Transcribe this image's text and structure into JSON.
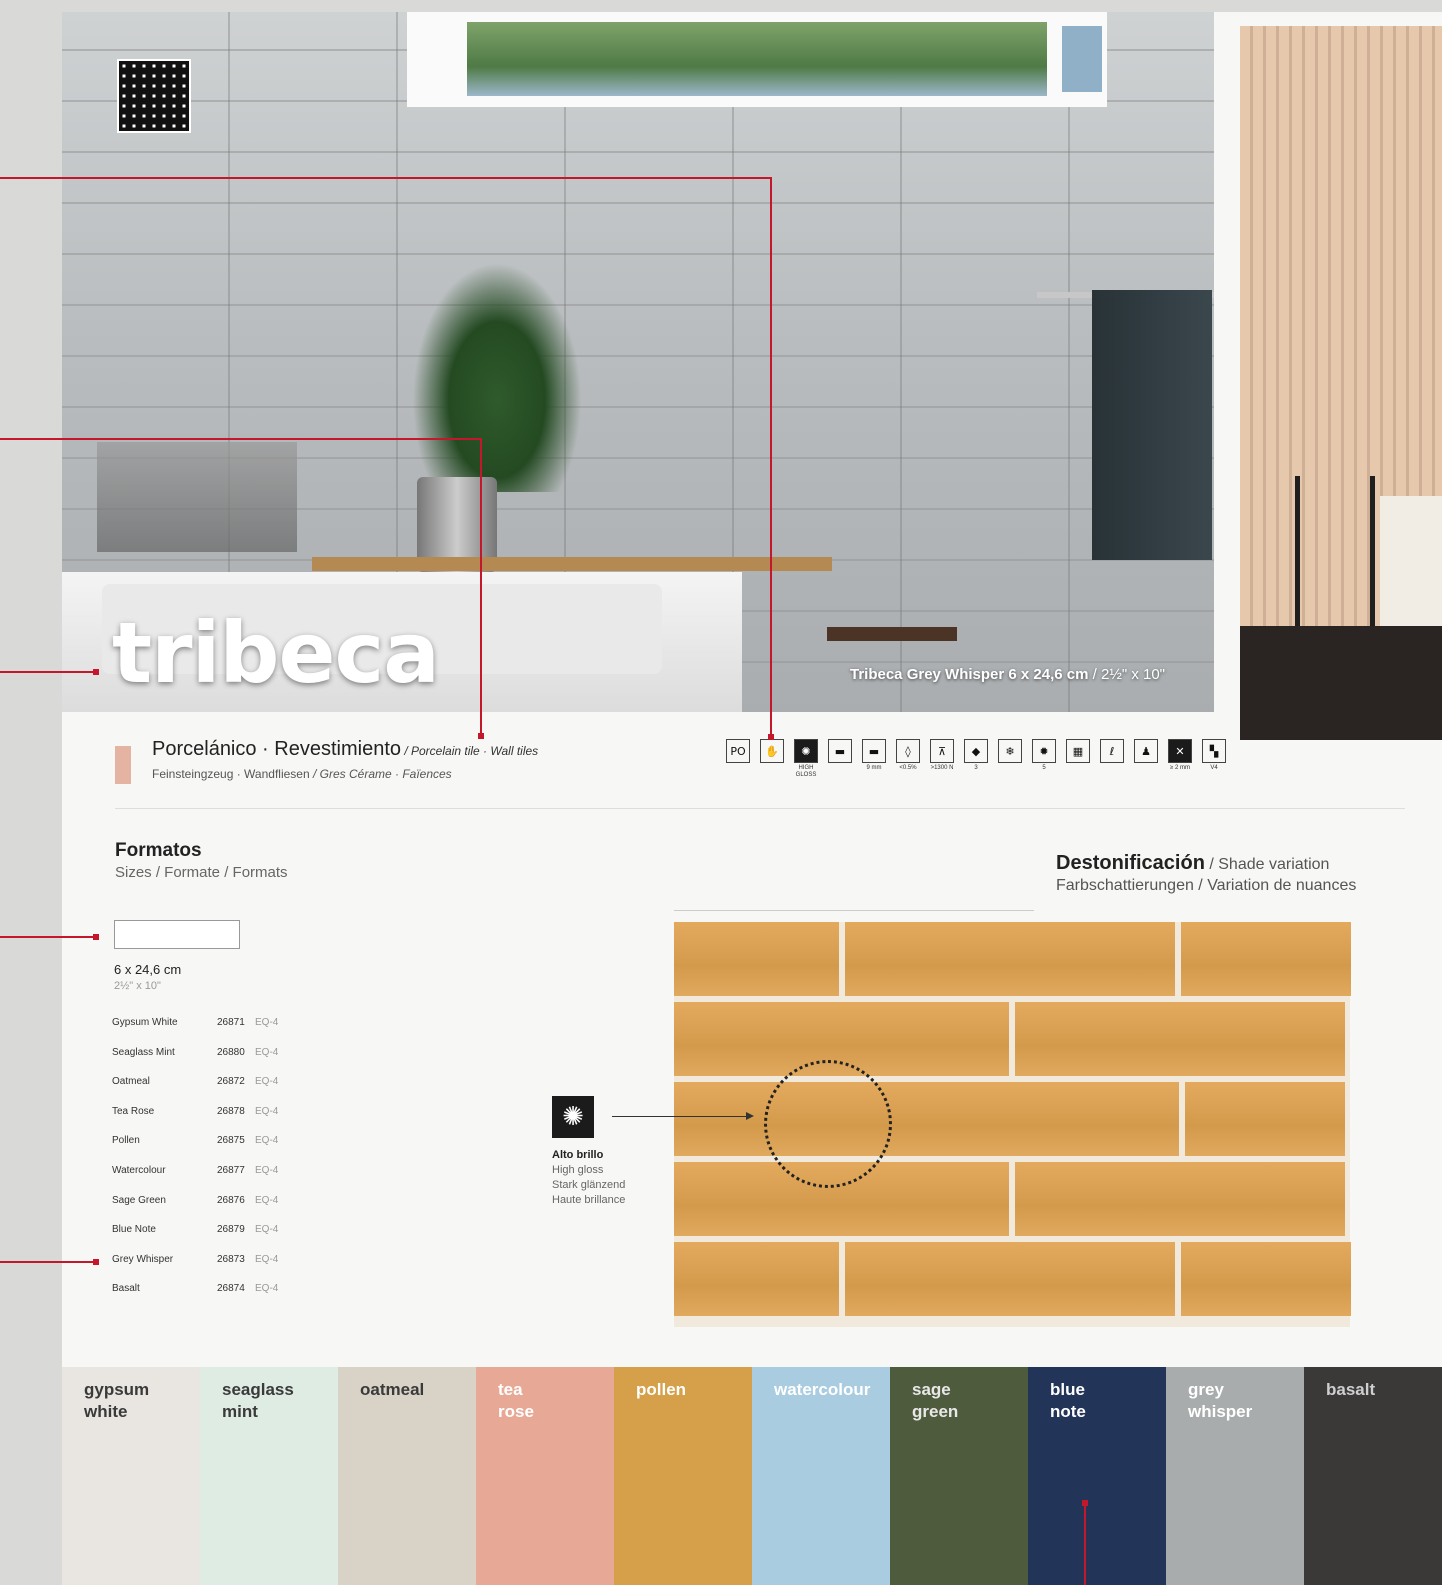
{
  "hero": {
    "title": "tribeca",
    "caption_main": "Tribeca Grey Whisper 6 x 24,6 cm",
    "caption_alt": " / 2½\" x 10\""
  },
  "header": {
    "main": "Porcelánico · Revestimiento",
    "main_alt": " / Porcelain tile · Wall tiles",
    "sub": "Feinsteingzeug · Wandfliesen",
    "sub_alt": " / Gres Cérame · Faïences"
  },
  "icons": [
    {
      "name": "po-icon",
      "glyph": "PO",
      "label": "",
      "solid": false
    },
    {
      "name": "hand-icon",
      "glyph": "✋",
      "label": "",
      "solid": false
    },
    {
      "name": "high-gloss-icon",
      "glyph": "✺",
      "label": "HIGH GLOSS",
      "solid": true
    },
    {
      "name": "tile-shape-icon",
      "glyph": "▬",
      "label": "",
      "solid": false
    },
    {
      "name": "thickness-icon",
      "glyph": "▬",
      "label": "9 mm",
      "solid": false
    },
    {
      "name": "water-drop-icon",
      "glyph": "◊",
      "label": "<0.5%",
      "solid": false
    },
    {
      "name": "breaking-strength-icon",
      "glyph": "⊼",
      "label": ">1300 N",
      "solid": false
    },
    {
      "name": "abrasion-icon",
      "glyph": "◆",
      "label": "3",
      "solid": false
    },
    {
      "name": "frost-icon",
      "glyph": "❄",
      "label": "",
      "solid": false
    },
    {
      "name": "light-icon",
      "glyph": "✹",
      "label": "5",
      "solid": false
    },
    {
      "name": "pattern-icon",
      "glyph": "▦",
      "label": "",
      "solid": false
    },
    {
      "name": "thermal-icon",
      "glyph": "ℓ",
      "label": "",
      "solid": false
    },
    {
      "name": "chemical-icon",
      "glyph": "♟",
      "label": "",
      "solid": false
    },
    {
      "name": "joint-icon",
      "glyph": "✕",
      "label": "≥ 2 mm",
      "solid": true
    },
    {
      "name": "variation-icon",
      "glyph": "▚",
      "label": "V4",
      "solid": false
    }
  ],
  "formats": {
    "title": "Formatos",
    "subtitle": "Sizes / Formate / Formats",
    "size_cm": "6 x 24,6 cm",
    "size_in": "2½\" x 10\"",
    "refs": [
      {
        "name": "Gypsum White",
        "code": "26871",
        "eq": "EQ-4"
      },
      {
        "name": "Seaglass Mint",
        "code": "26880",
        "eq": "EQ-4"
      },
      {
        "name": "Oatmeal",
        "code": "26872",
        "eq": "EQ-4"
      },
      {
        "name": "Tea Rose",
        "code": "26878",
        "eq": "EQ-4"
      },
      {
        "name": "Pollen",
        "code": "26875",
        "eq": "EQ-4"
      },
      {
        "name": "Watercolour",
        "code": "26877",
        "eq": "EQ-4"
      },
      {
        "name": "Sage Green",
        "code": "26876",
        "eq": "EQ-4"
      },
      {
        "name": "Blue Note",
        "code": "26879",
        "eq": "EQ-4"
      },
      {
        "name": "Grey Whisper",
        "code": "26873",
        "eq": "EQ-4"
      },
      {
        "name": "Basalt",
        "code": "26874",
        "eq": "EQ-4"
      }
    ]
  },
  "shade": {
    "title": "Destonificación",
    "title_alt": " / Shade variation",
    "subtitle": "Farbschattierungen / Variation de nuances"
  },
  "gloss": {
    "title": "Alto brillo",
    "en": "High gloss",
    "de": "Stark glänzend",
    "fr": "Haute brillance"
  },
  "colors": [
    {
      "label": "gypsum\nwhite",
      "bg": "#e9e6e1",
      "fg": "#3a3a3a"
    },
    {
      "label": "seaglass\nmint",
      "bg": "#dfece4",
      "fg": "#3a3a3a"
    },
    {
      "label": "oatmeal",
      "bg": "#d9d2c7",
      "fg": "#3a3a3a"
    },
    {
      "label": "tea\nrose",
      "bg": "#e7a895",
      "fg": "#ffffff"
    },
    {
      "label": "pollen",
      "bg": "#d5a049",
      "fg": "#ffffff"
    },
    {
      "label": "watercolour",
      "bg": "#a9cce0",
      "fg": "#ffffff"
    },
    {
      "label": "sage\ngreen",
      "bg": "#4f5b3d",
      "fg": "#e8e8e8"
    },
    {
      "label": "blue\nnote",
      "bg": "#223458",
      "fg": "#ffffff"
    },
    {
      "label": "grey\nwhisper",
      "bg": "#a9acad",
      "fg": "#ffffff"
    },
    {
      "label": "basalt",
      "bg": "#3b3838",
      "fg": "#cfcfcf"
    }
  ],
  "accent_color": "#c5172c"
}
